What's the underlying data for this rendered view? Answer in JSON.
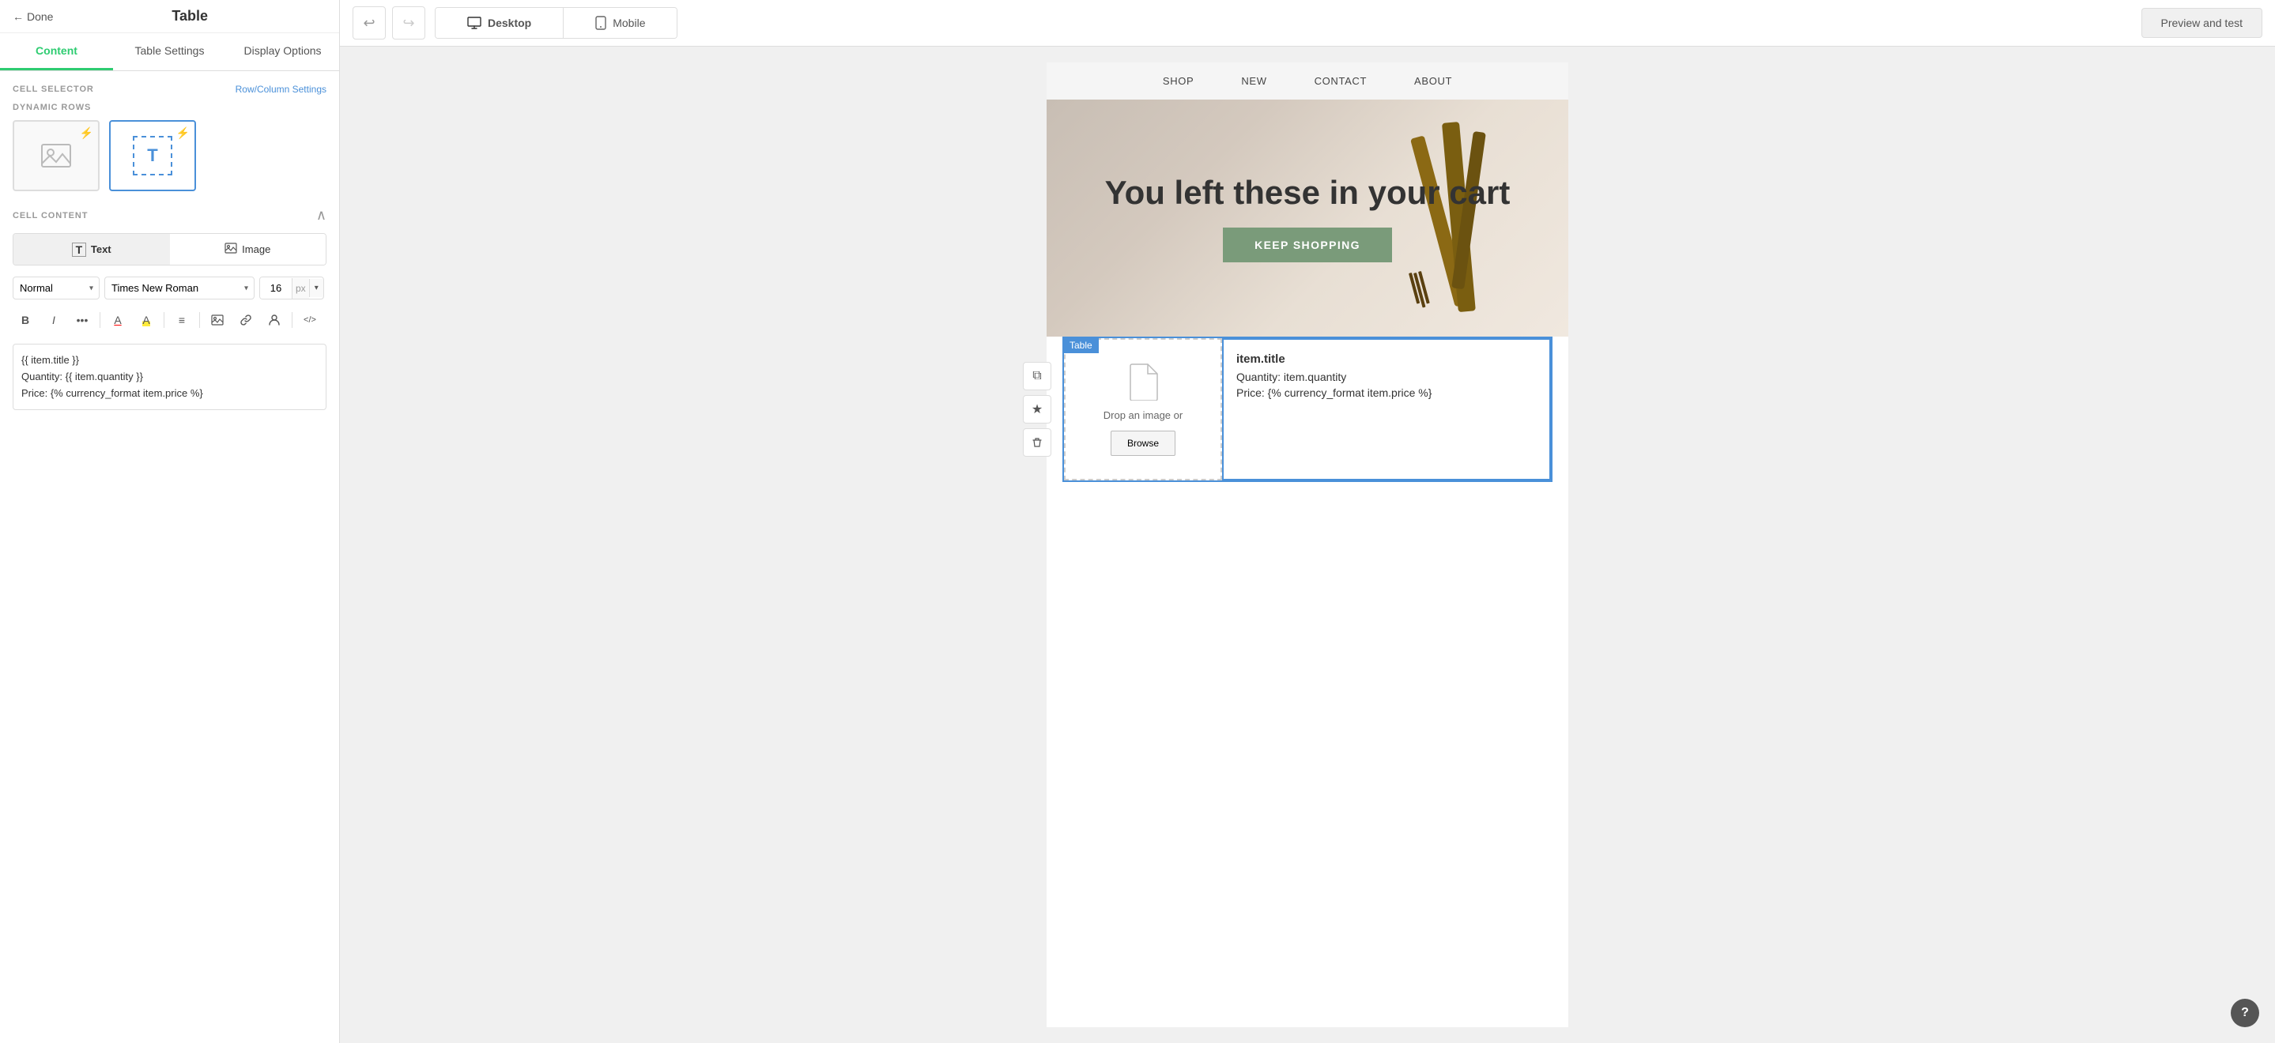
{
  "app": {
    "title": "Table"
  },
  "header": {
    "back_label": "Done",
    "title": "Table",
    "preview_btn": "Preview and test"
  },
  "tabs": [
    {
      "id": "content",
      "label": "Content",
      "active": true
    },
    {
      "id": "table-settings",
      "label": "Table Settings",
      "active": false
    },
    {
      "id": "display-options",
      "label": "Display Options",
      "active": false
    }
  ],
  "cell_selector": {
    "label": "CELL SELECTOR",
    "link": "Row/Column Settings"
  },
  "dynamic_rows": {
    "label": "DYNAMIC ROWS"
  },
  "cell_content": {
    "label": "CELL CONTENT",
    "text_btn": "Text",
    "image_btn": "Image"
  },
  "font_toolbar": {
    "style": "Normal",
    "family": "Times New Roman",
    "size": "16",
    "unit": "px"
  },
  "format_buttons": {
    "bold": "B",
    "italic": "I",
    "more": "⋯",
    "text_color": "A",
    "highlight": "A",
    "align": "≡",
    "image": "🖼",
    "link": "🔗",
    "person": "👤",
    "code": "</"
  },
  "editor_content": {
    "line1": "{{ item.title }}",
    "line2": "Quantity: {{ item.quantity }}",
    "line3": "Price: {% currency_format item.price %}"
  },
  "device_toggle": {
    "desktop_label": "Desktop",
    "mobile_label": "Mobile"
  },
  "preview": {
    "nav_items": [
      "SHOP",
      "NEW",
      "CONTACT",
      "ABOUT"
    ],
    "hero_title": "You left these in your cart",
    "hero_btn": "KEEP SHOPPING",
    "table_label": "Table"
  },
  "table_cell": {
    "drop_text": "Drop an image or",
    "browse_btn": "Browse",
    "title_template": "item.title",
    "qty_template": "Quantity: item.quantity",
    "price_template": "Price: {% currency_format item.price %}"
  },
  "side_actions": {
    "copy": "⧉",
    "star": "★",
    "delete": "🗑"
  },
  "help": {
    "label": "?"
  }
}
